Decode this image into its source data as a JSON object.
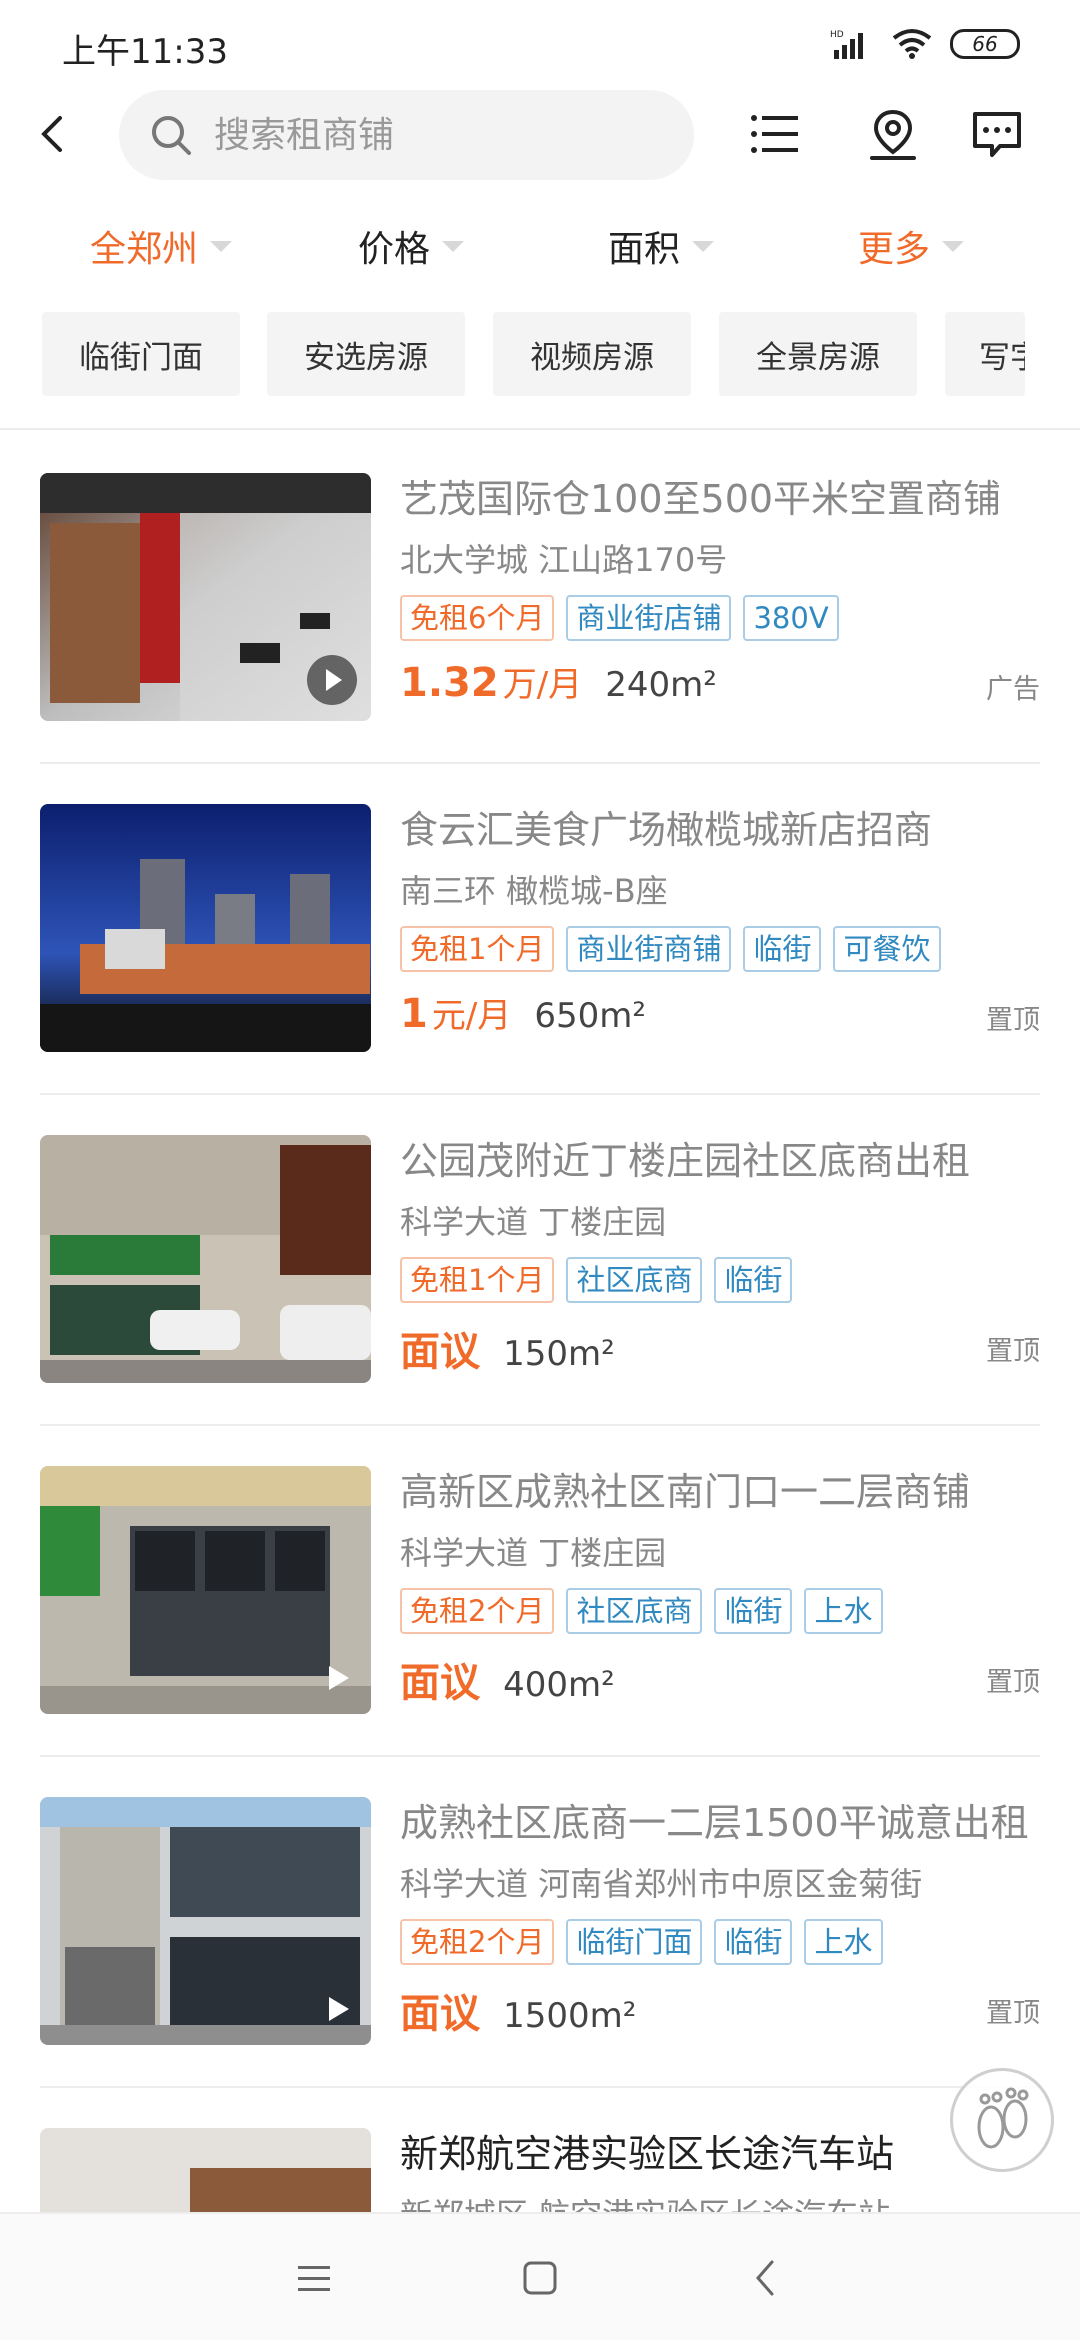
{
  "status_bar": {
    "time": "上午11:33",
    "battery": "66"
  },
  "header": {
    "search_placeholder": "搜索租商铺"
  },
  "filters": [
    {
      "label": "全郑州",
      "active": true
    },
    {
      "label": "价格",
      "active": false
    },
    {
      "label": "面积",
      "active": false
    },
    {
      "label": "更多",
      "active": true
    }
  ],
  "quick_tags": [
    "临街门面",
    "安选房源",
    "视频房源",
    "全景房源",
    "写字"
  ],
  "listings": [
    {
      "title": "艺茂国际仓100至500平米空置商铺",
      "address": "北大学城 江山路170号",
      "badges": [
        {
          "text": "免租6个月",
          "color": "orange"
        },
        {
          "text": "商业街店铺",
          "color": "blue"
        },
        {
          "text": "380V",
          "color": "blue"
        }
      ],
      "price": "1.32",
      "price_unit": "万/月",
      "area": "240m²",
      "right_label": "广告"
    },
    {
      "title": "食云汇美食广场橄榄城新店招商",
      "address": "南三环 橄榄城-B座",
      "badges": [
        {
          "text": "免租1个月",
          "color": "orange"
        },
        {
          "text": "商业街商铺",
          "color": "blue"
        },
        {
          "text": "临街",
          "color": "blue"
        },
        {
          "text": "可餐饮",
          "color": "blue"
        }
      ],
      "price": "1",
      "price_unit": "元/月",
      "area": "650m²",
      "right_label": "置顶"
    },
    {
      "title": "公园茂附近丁楼庄园社区底商出租",
      "address": "科学大道 丁楼庄园",
      "badges": [
        {
          "text": "免租1个月",
          "color": "orange"
        },
        {
          "text": "社区底商",
          "color": "blue"
        },
        {
          "text": "临街",
          "color": "blue"
        }
      ],
      "price": "面议",
      "price_unit": "",
      "area": "150m²",
      "right_label": "置顶"
    },
    {
      "title": "高新区成熟社区南门口一二层商铺",
      "address": "科学大道 丁楼庄园",
      "badges": [
        {
          "text": "免租2个月",
          "color": "orange"
        },
        {
          "text": "社区底商",
          "color": "blue"
        },
        {
          "text": "临街",
          "color": "blue"
        },
        {
          "text": "上水",
          "color": "blue"
        }
      ],
      "price": "面议",
      "price_unit": "",
      "area": "400m²",
      "right_label": "置顶"
    },
    {
      "title": "成熟社区底商一二层1500平诚意出租",
      "address": "科学大道 河南省郑州市中原区金菊街",
      "badges": [
        {
          "text": "免租2个月",
          "color": "orange"
        },
        {
          "text": "临街门面",
          "color": "blue"
        },
        {
          "text": "临街",
          "color": "blue"
        },
        {
          "text": "上水",
          "color": "blue"
        }
      ],
      "price": "面议",
      "price_unit": "",
      "area": "1500m²",
      "right_label": "置顶"
    },
    {
      "title": "新郑航空港实验区长途汽车站",
      "address": "新郑城区 航空港实验区长途汽车站",
      "badges": [],
      "price": "",
      "price_unit": "",
      "area": "",
      "right_label": ""
    }
  ],
  "colors": {
    "accent": "#f06a2a",
    "tag_blue": "#3089c0"
  }
}
